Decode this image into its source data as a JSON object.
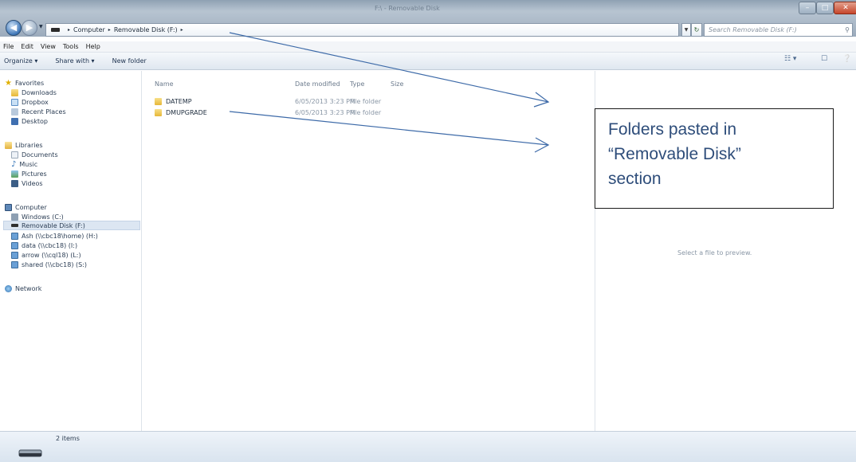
{
  "window": {
    "title_text": "F:\\ - Removable Disk"
  },
  "address": {
    "segments": [
      "Computer",
      "Removable Disk (F:)"
    ],
    "search_placeholder": "Search Removable Disk (F:)"
  },
  "menu": [
    "File",
    "Edit",
    "View",
    "Tools",
    "Help"
  ],
  "commands": {
    "organize": "Organize ▾",
    "share_with": "Share with ▾",
    "new_folder": "New folder"
  },
  "nav": {
    "favorites": {
      "label": "Favorites",
      "items": [
        "Downloads",
        "Dropbox",
        "Recent Places",
        "Desktop"
      ]
    },
    "libraries": {
      "label": "Libraries",
      "items": [
        "Documents",
        "Music",
        "Pictures",
        "Videos"
      ]
    },
    "computer": {
      "label": "Computer",
      "items": [
        "Windows (C:)",
        "Removable Disk (F:)",
        "Ash (\\\\cbc18\\home) (H:)",
        "data (\\\\cbc18) (I:)",
        "arrow (\\\\cql18) (L:)",
        "shared (\\\\cbc18) (S:)"
      ]
    },
    "network": "Network"
  },
  "columns": {
    "name": "Name",
    "date_modified": "Date modified",
    "type": "Type",
    "size": "Size"
  },
  "files": [
    {
      "name": "DATEMP",
      "date": "6/05/2013 3:23 PM",
      "type": "File folder"
    },
    {
      "name": "DMUPGRADE",
      "date": "6/05/2013 3:23 PM",
      "type": "File folder"
    }
  ],
  "preview": {
    "empty_text": "Select a file to preview."
  },
  "status": {
    "count": "2 items"
  },
  "callout": {
    "line1": "Folders pasted in",
    "line2": "“Removable Disk”",
    "line3": "section"
  },
  "colors": {
    "callout_text": "#2e4d7a",
    "arrow": "#3d6aa8"
  }
}
